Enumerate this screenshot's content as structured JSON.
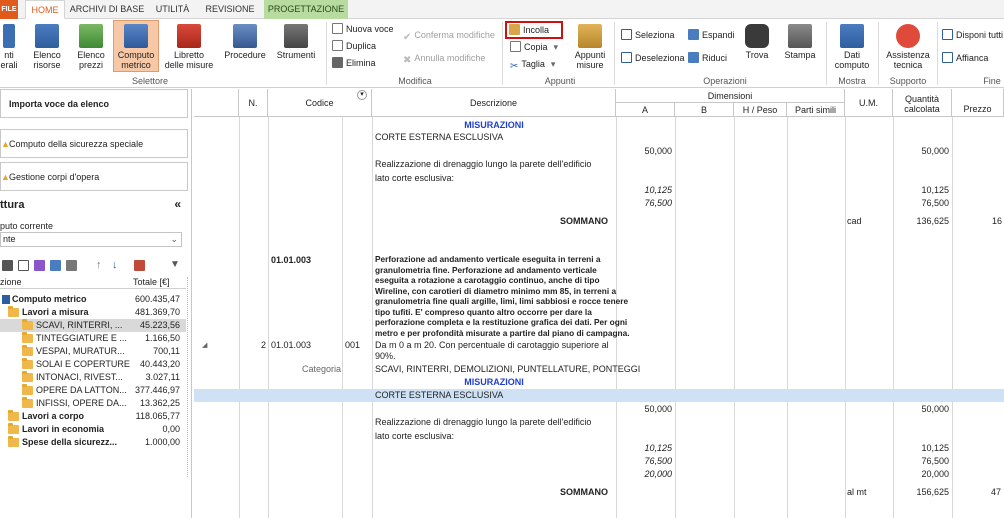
{
  "tabs": {
    "file": "FILE",
    "home": "HOME",
    "archivi": "ARCHIVI DI BASE",
    "utilita": "UTILITÀ",
    "revisione": "REVISIONE",
    "progettazione": "PROGETTAZIONE"
  },
  "ribbon": {
    "btn_calcoli": "nti\nerali",
    "elenco_risorse": "Elenco\nrisorse",
    "elenco_prezzi": "Elenco\nprezzi",
    "computo_metrico": "Computo\nmetrico",
    "libretto_misure": "Libretto\ndelle misure",
    "procedure": "Procedure",
    "strumenti": "Strumenti",
    "selettore_label": "Selettore",
    "nuova_voce": "Nuova voce",
    "duplica": "Duplica",
    "elimina": "Elimina",
    "conferma_modifiche": "Conferma modifiche",
    "annulla_modifiche": "Annulla modifiche",
    "modifica_label": "Modifica",
    "incolla": "Incolla",
    "copia": "Copia",
    "taglia": "Taglia",
    "appunti_misure": "Appunti\nmisure",
    "appunti_label": "Appunti",
    "seleziona": "Seleziona",
    "deseleziona": "Deseleziona",
    "espandi": "Espandi",
    "riduci": "Riduci",
    "trova": "Trova",
    "stampa": "Stampa",
    "operazioni_label": "Operazioni",
    "dati_computo": "Dati\ncomputo",
    "mostra_label": "Mostra",
    "assistenza_tecnica": "Assistenza\ntecnica",
    "supporto_label": "Supporto",
    "disponi_tutti": "Disponi tutti",
    "affianca": "Affianca",
    "finestre_label": "Fine"
  },
  "left": {
    "importa": "Importa voce da elenco",
    "computo_sicurezza": "Computo della sicurezza speciale",
    "gestione_corpi": "Gestione corpi d'opera",
    "struttura_title": "ttura",
    "collapse": "«",
    "computo_corrente_label": "puto corrente",
    "computo_corrente_value": "nte",
    "col_descr": "zione",
    "col_totale": "Totale [€]",
    "tree": [
      {
        "label": "Computo metrico",
        "value": "600.435,47",
        "bold": true,
        "indent": 0
      },
      {
        "label": "Lavori a misura",
        "value": "481.369,70",
        "bold": true,
        "indent": 1
      },
      {
        "label": "SCAVI, RINTERRI, ...",
        "value": "45.223,56",
        "bold": false,
        "indent": 2,
        "sel": true
      },
      {
        "label": "TINTEGGIATURE E ...",
        "value": "1.166,50",
        "bold": false,
        "indent": 2
      },
      {
        "label": "VESPAI, MURATUR...",
        "value": "700,11",
        "bold": false,
        "indent": 2
      },
      {
        "label": "SOLAI E COPERTURE",
        "value": "40.443,20",
        "bold": false,
        "indent": 2
      },
      {
        "label": "INTONACI, RIVEST...",
        "value": "3.027,11",
        "bold": false,
        "indent": 2
      },
      {
        "label": "OPERE DA LATTON...",
        "value": "377.446,97",
        "bold": false,
        "indent": 2
      },
      {
        "label": "INFISSI, OPERE DA...",
        "value": "13.362,25",
        "bold": false,
        "indent": 2
      },
      {
        "label": "Lavori a corpo",
        "value": "118.065,77",
        "bold": true,
        "indent": 1
      },
      {
        "label": "Lavori in economia",
        "value": "0,00",
        "bold": true,
        "indent": 1
      },
      {
        "label": "Spese della sicurezz...",
        "value": "1.000,00",
        "bold": true,
        "indent": 1
      }
    ]
  },
  "grid": {
    "headers": {
      "n": "N.",
      "codice": "Codice",
      "descrizione": "Descrizione",
      "dimensioni": "Dimensioni",
      "a": "A",
      "b": "B",
      "h": "H / Peso",
      "parti": "Parti simili",
      "um": "U.M.",
      "quantita": "Quantità calcolata",
      "prezzo": "Prezzo"
    },
    "misurazioni": "MISURAZIONI",
    "corte": "CORTE ESTERNA ESCLUSIVA",
    "drenaggio_1": "Realizzazione di drenaggio lungo la parete dell'edificio",
    "drenaggio_2": "lato corte esclusiva:",
    "v50": "50,000",
    "v10": "10,125",
    "v76": "76,500",
    "v20": "20,000",
    "sommano": "SOMMANO",
    "um_cad": "cad",
    "q1": "136,625",
    "p1": "16",
    "codice_title": "01.01.003",
    "perforazione": [
      "Perforazione ad andamento verticale eseguita in terreni a",
      "granulometria fine. Perforazione ad andamento verticale",
      "eseguita a rotazione a carotaggio continuo, anche di tipo",
      "Wireline, con carotieri di diametro minimo mm 85, in terreni a",
      "granulometria fine quali argille, limi, limi sabbiosi e rocce tenere",
      "tipo tufiti. E' compreso quanto altro occorre per dare la",
      "perforazione completa e la restituzione grafica dei dati. Per ogni",
      "metro e per profondità misurate a partire dal piano di campagna."
    ],
    "row_n": "2",
    "row_codice": "01.01.003",
    "row_sub": "001",
    "da_m_1": "Da m 0 a m 20. Con percentuale di carotaggio superiore al",
    "da_m_2": "90%.",
    "categoria": "Categoria",
    "categoria_value": "SCAVI, RINTERRI, DEMOLIZIONI, PUNTELLATURE, PONTEGGI",
    "um_almt": "al mt",
    "q2": "156,625",
    "p2": "47"
  }
}
